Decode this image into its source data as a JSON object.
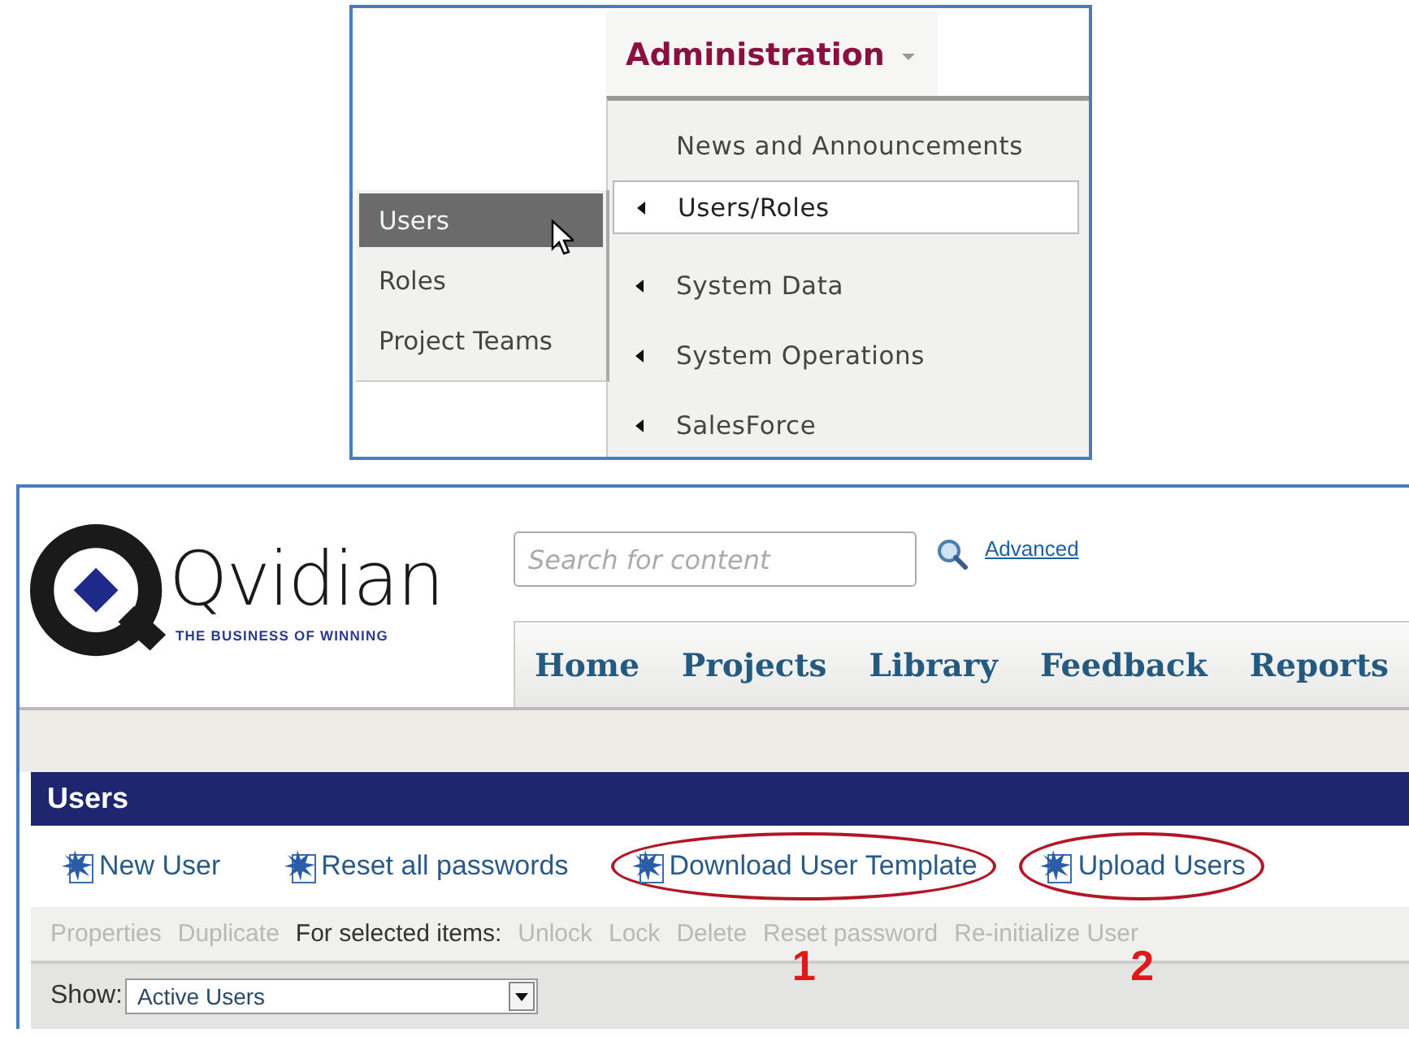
{
  "admin_menu": {
    "title": "Administration",
    "items": [
      {
        "label": "News and Announcements",
        "has_submenu": false,
        "selected": false
      },
      {
        "label": "Users/Roles",
        "has_submenu": true,
        "selected": true
      },
      {
        "label": "System Data",
        "has_submenu": true,
        "selected": false
      },
      {
        "label": "System Operations",
        "has_submenu": true,
        "selected": false
      },
      {
        "label": "SalesForce",
        "has_submenu": true,
        "selected": false
      }
    ],
    "submenu": [
      {
        "label": "Users",
        "selected": true
      },
      {
        "label": "Roles",
        "selected": false
      },
      {
        "label": "Project Teams",
        "selected": false
      }
    ]
  },
  "app": {
    "logo": {
      "name": "Qvidian",
      "tagline": "THE BUSINESS OF WINNING"
    },
    "search": {
      "placeholder": "Search for content"
    },
    "advanced_link": "Advanced",
    "nav": [
      {
        "label": "Home"
      },
      {
        "label": "Projects"
      },
      {
        "label": "Library"
      },
      {
        "label": "Feedback"
      },
      {
        "label": "Reports"
      }
    ],
    "panel": {
      "title": "Users",
      "toolbar": [
        {
          "label": "New User",
          "highlighted": false
        },
        {
          "label": "Reset all passwords",
          "highlighted": false
        },
        {
          "label": "Download User Template",
          "highlighted": true,
          "marker": "1"
        },
        {
          "label": "Upload Users",
          "highlighted": true,
          "marker": "2"
        }
      ],
      "actions": [
        {
          "kind": "action",
          "label": "Properties",
          "disabled": true
        },
        {
          "kind": "action",
          "label": "Duplicate",
          "disabled": true
        },
        {
          "kind": "label",
          "label": "For selected items:"
        },
        {
          "kind": "action",
          "label": "Unlock",
          "disabled": true
        },
        {
          "kind": "action",
          "label": "Lock",
          "disabled": true
        },
        {
          "kind": "action",
          "label": "Delete",
          "disabled": true
        },
        {
          "kind": "action",
          "label": "Reset password",
          "disabled": true
        },
        {
          "kind": "action",
          "label": "Re-initialize User",
          "disabled": true
        }
      ],
      "filter": {
        "label": "Show:",
        "value": "Active Users"
      }
    }
  }
}
